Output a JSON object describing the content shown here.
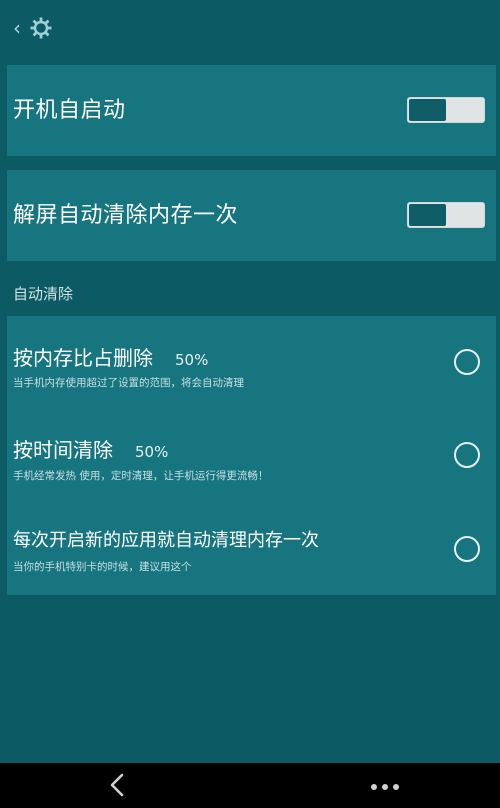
{
  "header": {
    "back_icon": "chevron-left-icon",
    "settings_icon": "gear-icon"
  },
  "toggles": [
    {
      "label": "开机自启动",
      "state": "off"
    },
    {
      "label": "解屏自动清除内存一次",
      "state": "off"
    }
  ],
  "section": {
    "title": "自动清除"
  },
  "options": [
    {
      "title": "按内存比占删除",
      "value": "50%",
      "description": "当手机内存使用超过了设置的范围，将会自动清理",
      "selected": false
    },
    {
      "title": "按时间清除",
      "value": "50%",
      "description": "手机经常发热 使用，定时清理，让手机运行得更流畅！",
      "selected": false
    },
    {
      "title": "每次开启新的应用就自动清理内存一次",
      "value": "",
      "description": "当你的手机特别卡的时候，建议用这个",
      "selected": false
    }
  ],
  "navbar": {
    "back_icon": "back-arrow-icon",
    "menu_icon": "more-dots-icon"
  },
  "colors": {
    "background": "#0c5a63",
    "card": "#177580",
    "toggle_knob": "#0f5d66",
    "toggle_track": "#e1e4e5",
    "navbar": "#000000"
  }
}
